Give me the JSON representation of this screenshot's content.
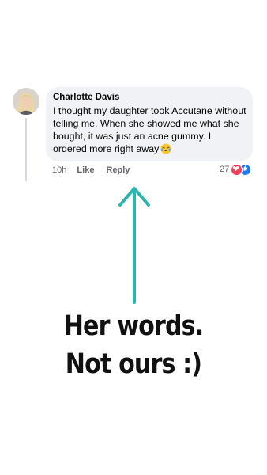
{
  "comment": {
    "author": "Charlotte Davis",
    "text": "I thought my daughter took Accutane without telling me. When she showed me what she bought, it was just an acne gummy. I ordered more right away",
    "emoji": "laughing-tears-emoji",
    "time": "10h",
    "like_label": "Like",
    "reply_label": "Reply",
    "reaction_count": "27",
    "reactions": [
      "heart-icon",
      "like-icon"
    ]
  },
  "caption": {
    "line1": "Her words.",
    "line2": "Not ours :)"
  },
  "colors": {
    "arrow": "#2bb5ac",
    "bubble": "#f0f2f5",
    "meta_text": "#65676b",
    "heart": "#f33e58",
    "like": "#1877f2"
  }
}
